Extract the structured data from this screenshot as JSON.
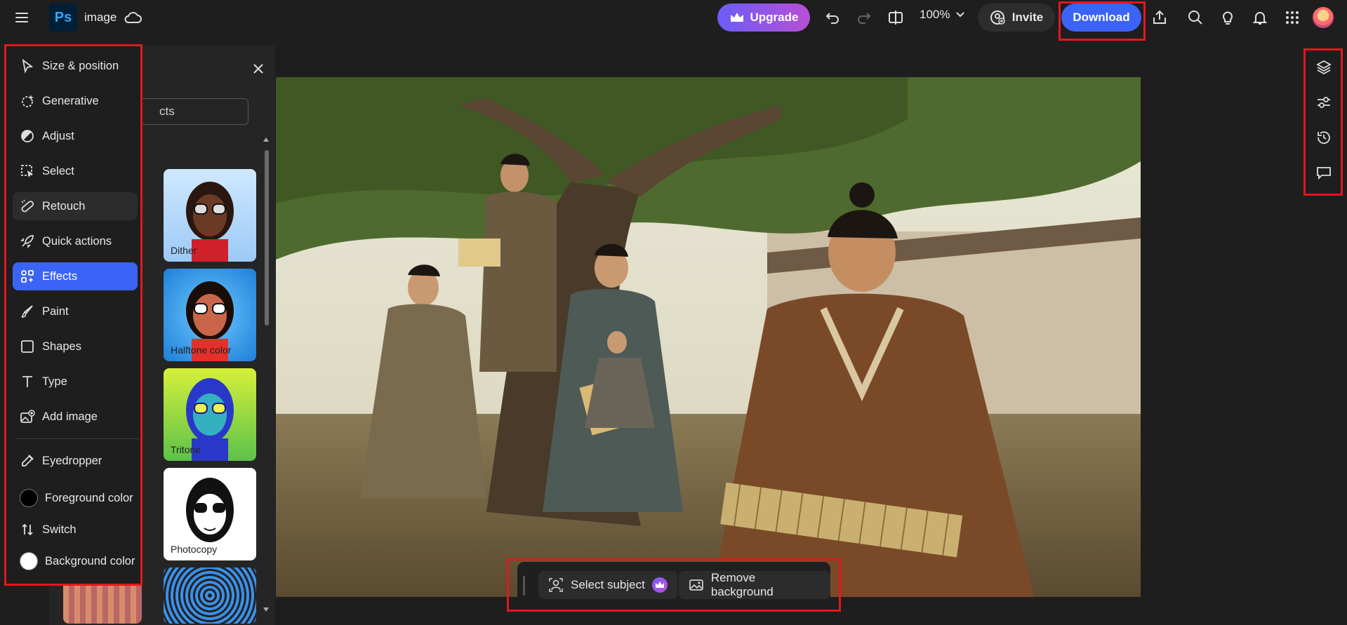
{
  "app": {
    "logo": "Ps",
    "doc_name": "image"
  },
  "topbar": {
    "upgrade_label": "Upgrade",
    "zoom": "100%",
    "invite_label": "Invite",
    "download_label": "Download",
    "icons": [
      "menu-icon",
      "cloud-icon",
      "undo-icon",
      "redo-icon",
      "compare-icon",
      "share-icon",
      "search-icon",
      "lightbulb-icon",
      "bell-icon",
      "apps-icon",
      "avatar"
    ]
  },
  "leftbar": {
    "items": [
      {
        "label": "Size & position",
        "icon": "cursor-icon"
      },
      {
        "label": "Generative",
        "icon": "sparkle-icon"
      },
      {
        "label": "Adjust",
        "icon": "adjust-icon"
      },
      {
        "label": "Select",
        "icon": "select-icon"
      },
      {
        "label": "Retouch",
        "icon": "retouch-icon"
      },
      {
        "label": "Quick actions",
        "icon": "rocket-icon"
      },
      {
        "label": "Effects",
        "icon": "effects-icon"
      },
      {
        "label": "Paint",
        "icon": "brush-icon"
      },
      {
        "label": "Shapes",
        "icon": "square-icon"
      },
      {
        "label": "Type",
        "icon": "type-icon"
      },
      {
        "label": "Add image",
        "icon": "add-image-icon"
      }
    ],
    "tools": [
      {
        "label": "Eyedropper",
        "icon": "eyedropper-icon"
      },
      {
        "label": "Foreground color",
        "icon": "foreground-swatch"
      },
      {
        "label": "Switch",
        "icon": "switch-icon"
      },
      {
        "label": "Background color",
        "icon": "background-swatch"
      }
    ],
    "active": "Effects",
    "hover": "Retouch"
  },
  "panel": {
    "search_visible_text": "cts",
    "effects": [
      "Dither",
      "Halftone color",
      "Tritone",
      "Photocopy"
    ]
  },
  "context_bar": {
    "select_subject_label": "Select subject",
    "remove_background_label": "Remove background"
  },
  "colors": {
    "accent": "#3b63f5",
    "highlight": "#e3171e",
    "foreground": "#000000",
    "background": "#ffffff"
  }
}
